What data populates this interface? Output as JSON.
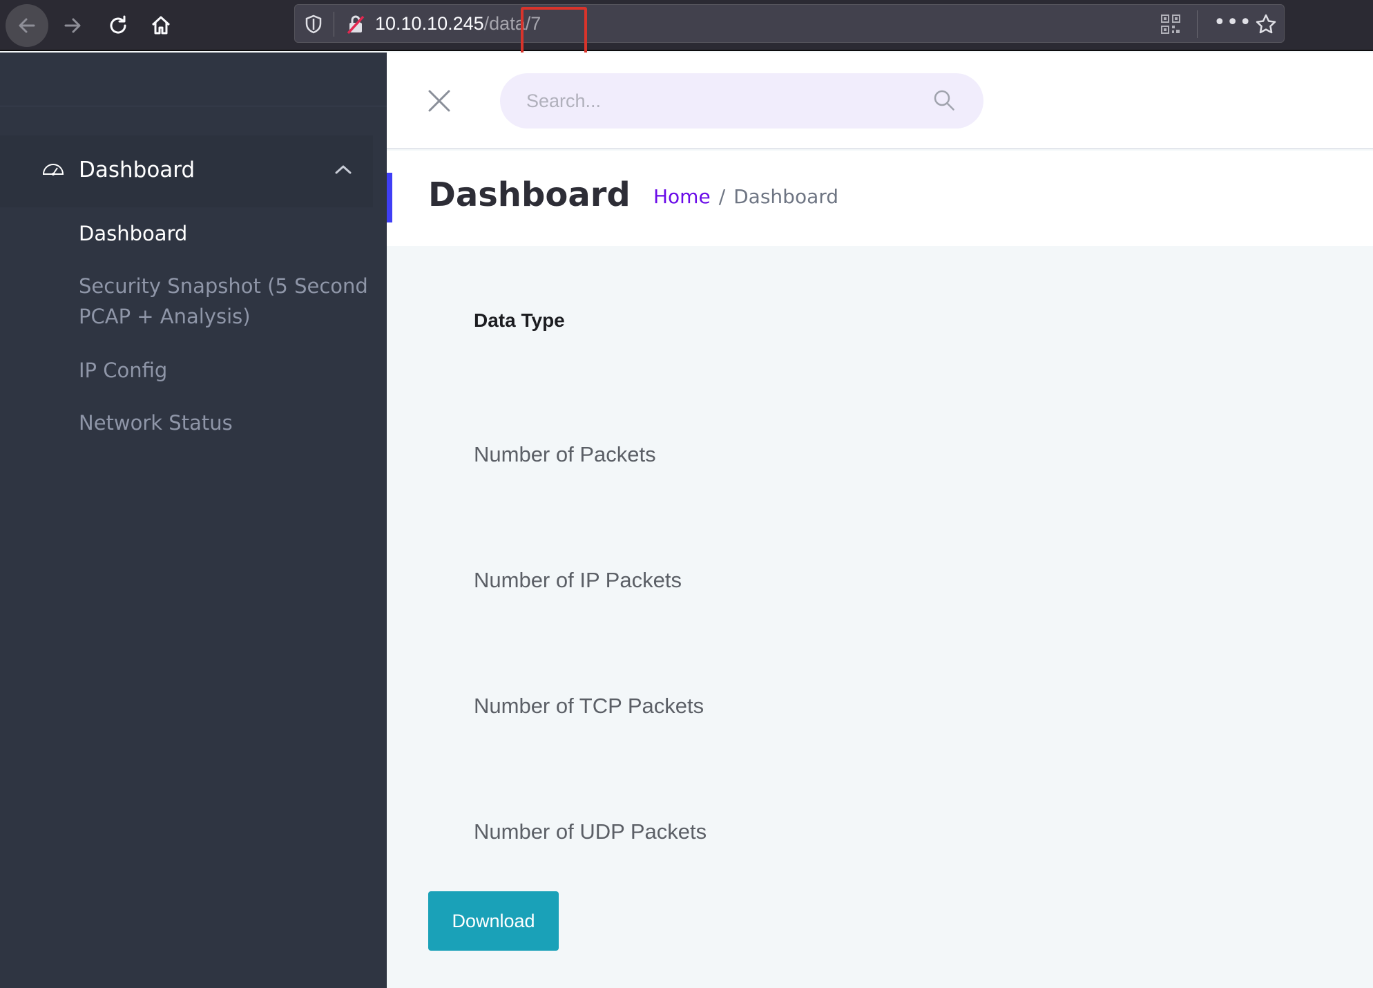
{
  "browser": {
    "url_host": "10.10.10.245",
    "url_path": "/data/7"
  },
  "sidebar": {
    "group_title": "Dashboard",
    "items": [
      {
        "label": "Dashboard",
        "active": true
      },
      {
        "label": "Security Snapshot (5 Second PCAP + Analysis)",
        "active": false
      },
      {
        "label": "IP Config",
        "active": false
      },
      {
        "label": "Network Status",
        "active": false
      }
    ]
  },
  "header": {
    "search_placeholder": "Search..."
  },
  "page": {
    "title": "Dashboard",
    "breadcrumb": {
      "home": "Home",
      "separator": "/",
      "current": "Dashboard"
    }
  },
  "content": {
    "header_label": "Data Type",
    "rows": [
      "Number of Packets",
      "Number of IP Packets",
      "Number of TCP Packets",
      "Number of UDP Packets"
    ],
    "download_label": "Download"
  },
  "colors": {
    "sidebar_bg": "#2f3542",
    "accent": "#3f3ef5",
    "link": "#6a0be8",
    "button": "#1aa1b8",
    "highlight": "#d8342b"
  }
}
